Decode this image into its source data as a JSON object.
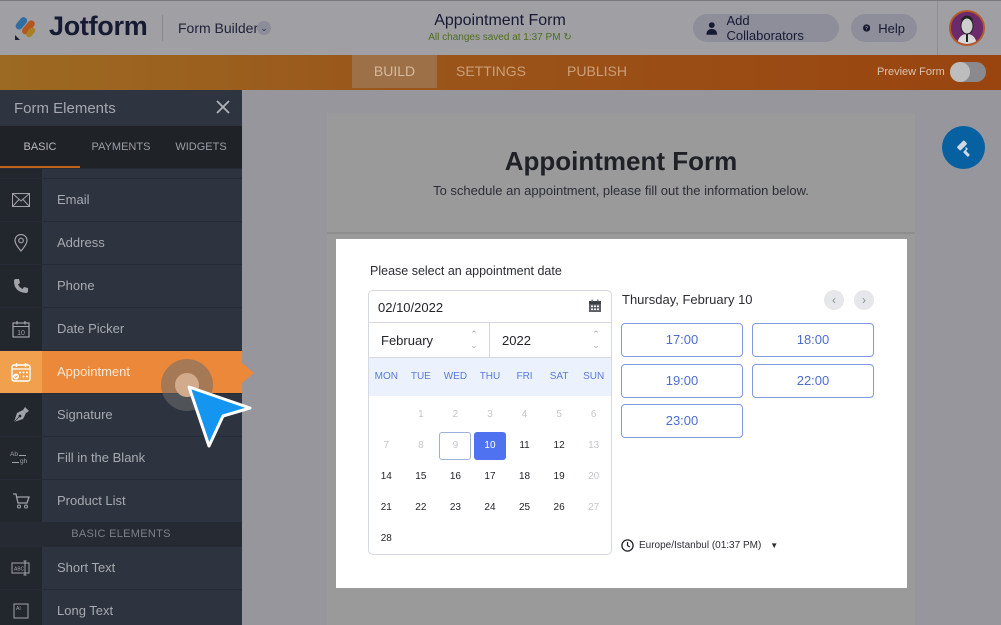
{
  "header": {
    "brand": "Jotform",
    "form_builder_label": "Form Builder",
    "form_title": "Appointment Form",
    "save_status": "All changes saved at 1:37 PM",
    "add_collaborators_label": "Add Collaborators",
    "help_label": "Help"
  },
  "toolbar": {
    "tabs": [
      {
        "label": "BUILD",
        "active": true
      },
      {
        "label": "SETTINGS",
        "active": false
      },
      {
        "label": "PUBLISH",
        "active": false
      }
    ],
    "preview_label": "Preview Form",
    "preview_enabled": false
  },
  "sidebar": {
    "title": "Form Elements",
    "tabs": [
      {
        "label": "BASIC",
        "active": true
      },
      {
        "label": "PAYMENTS",
        "active": false
      },
      {
        "label": "WIDGETS",
        "active": false
      }
    ],
    "items": [
      {
        "label": "Email",
        "icon": "envelope-icon"
      },
      {
        "label": "Address",
        "icon": "map-pin-icon"
      },
      {
        "label": "Phone",
        "icon": "phone-icon"
      },
      {
        "label": "Date Picker",
        "icon": "calendar-icon"
      },
      {
        "label": "Appointment",
        "icon": "appointment-calendar-icon",
        "active": true
      },
      {
        "label": "Signature",
        "icon": "pen-nib-icon"
      },
      {
        "label": "Fill in the Blank",
        "icon": "fill-blank-icon"
      },
      {
        "label": "Product List",
        "icon": "cart-icon"
      }
    ],
    "section_label": "BASIC ELEMENTS",
    "basic_items": [
      {
        "label": "Short Text",
        "icon": "short-text-icon"
      },
      {
        "label": "Long Text",
        "icon": "long-text-icon"
      }
    ],
    "calendar_icon_day": "10"
  },
  "form": {
    "title": "Appointment Form",
    "subtitle": "To schedule an appointment, please fill out the information below."
  },
  "appointment": {
    "label": "Please select an appointment date",
    "date_value": "02/10/2022",
    "month": "February",
    "year": "2022",
    "weekdays": [
      "MON",
      "TUE",
      "WED",
      "THU",
      "FRI",
      "SAT",
      "SUN"
    ],
    "weeks": [
      [
        {
          "d": ""
        },
        {
          "d": "1",
          "s": "disabled"
        },
        {
          "d": "2",
          "s": "disabled"
        },
        {
          "d": "3",
          "s": "disabled"
        },
        {
          "d": "4",
          "s": "disabled"
        },
        {
          "d": "5",
          "s": "disabled"
        },
        {
          "d": "6",
          "s": "disabled"
        }
      ],
      [
        {
          "d": "7",
          "s": "disabled"
        },
        {
          "d": "8",
          "s": "disabled"
        },
        {
          "d": "9",
          "s": "today"
        },
        {
          "d": "10",
          "s": "selected"
        },
        {
          "d": "11"
        },
        {
          "d": "12"
        },
        {
          "d": "13",
          "s": "disabled"
        }
      ],
      [
        {
          "d": "14"
        },
        {
          "d": "15"
        },
        {
          "d": "16"
        },
        {
          "d": "17"
        },
        {
          "d": "18"
        },
        {
          "d": "19"
        },
        {
          "d": "20",
          "s": "disabled"
        }
      ],
      [
        {
          "d": "21"
        },
        {
          "d": "22"
        },
        {
          "d": "23"
        },
        {
          "d": "24"
        },
        {
          "d": "25"
        },
        {
          "d": "26"
        },
        {
          "d": "27",
          "s": "disabled"
        }
      ],
      [
        {
          "d": "28"
        },
        {
          "d": ""
        },
        {
          "d": ""
        },
        {
          "d": ""
        },
        {
          "d": ""
        },
        {
          "d": ""
        },
        {
          "d": ""
        }
      ]
    ],
    "selected_day_heading": "Thursday, February 10",
    "prev_label": "‹",
    "next_label": "›",
    "slots": [
      "17:00",
      "18:00",
      "19:00",
      "22:00",
      "23:00"
    ],
    "timezone": "Europe/Istanbul (01:37 PM)"
  },
  "colors": {
    "accent_orange": "#ec883a",
    "selected_blue": "#4f73f0",
    "slot_blue": "#4d6dcb",
    "paint_button": "#07609f"
  }
}
